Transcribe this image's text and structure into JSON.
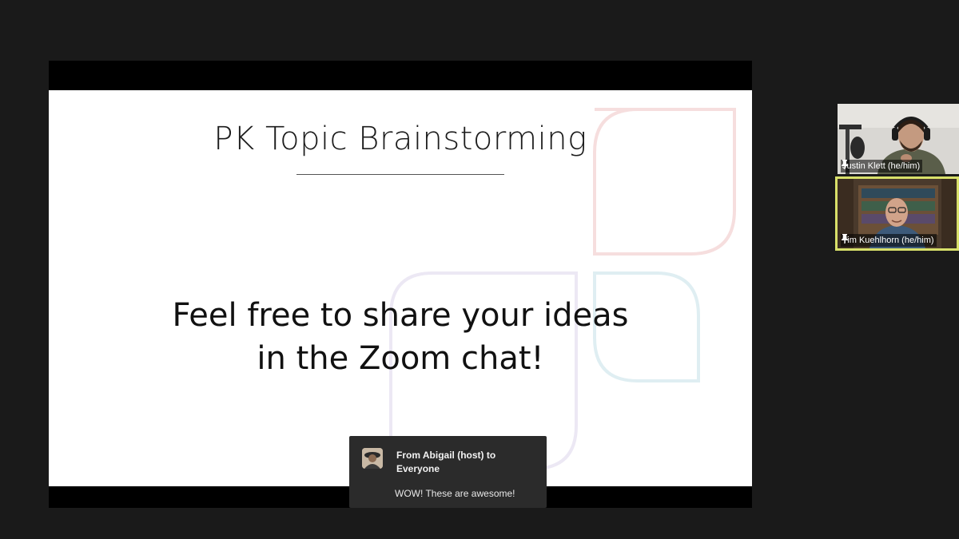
{
  "slide": {
    "title": "PK Topic Brainstorming",
    "body_line1": "Feel free to share your ideas",
    "body_line2": "in the Zoom chat!"
  },
  "chat_notification": {
    "from": "From Abigail (host) to Everyone",
    "message": "WOW! These are awesome!"
  },
  "participants": [
    {
      "name": "Justin Klett (he/him)",
      "icon": "pin-icon"
    },
    {
      "name": "Tim Kuehlhorn (he/him)",
      "icon": "pin-icon",
      "active_speaker": true
    }
  ],
  "colors": {
    "background": "#1a1a1a",
    "active_speaker_border": "#d8e06a",
    "toast_background": "#2b2b2b"
  }
}
